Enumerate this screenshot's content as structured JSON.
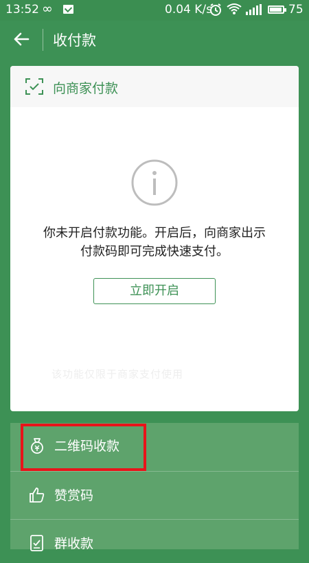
{
  "status_bar": {
    "time": "13:52",
    "infinity_glyph": "∞",
    "speed": "0.04 K/s",
    "battery": "75",
    "icons": [
      "mail-icon",
      "alarm-icon",
      "wifi-icon",
      "signal-icon",
      "battery-icon"
    ]
  },
  "topbar": {
    "title": "收付款",
    "back_icon": "back-arrow-icon"
  },
  "card": {
    "header_label": "向商家付款",
    "header_icon": "scan-icon",
    "notice_line1": "你未开启付款功能。开启后，向商家出示",
    "notice_line2": "付款码即可完成快速支付。",
    "button_label": "立即开启",
    "faded_hint": "该功能仅限于商家支付使用"
  },
  "menu": {
    "items": [
      {
        "label": "二维码收款",
        "icon": "money-bag-icon"
      },
      {
        "label": "赞赏码",
        "icon": "thumbs-up-icon"
      },
      {
        "label": "群收款",
        "icon": "group-bill-icon"
      }
    ]
  },
  "colors": {
    "background": "#3d9155",
    "accent": "#3d9155",
    "menu_bg": "#5ea36c",
    "highlight": "#e8141a"
  }
}
